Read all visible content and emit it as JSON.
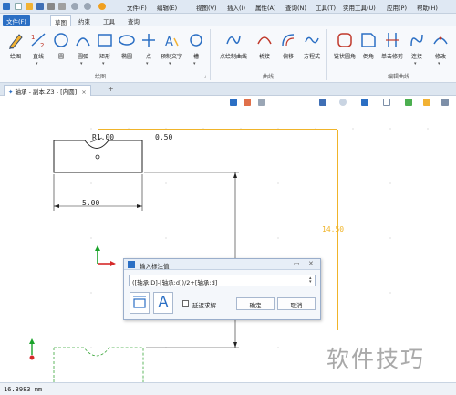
{
  "titlebar": {
    "menu": [
      "文件(F)",
      "编辑(E)",
      "视图(V)",
      "插入(I)",
      "属性(A)",
      "查询(N)",
      "工具(T)",
      "实用工具(U)",
      "应用(P)",
      "帮助(H)"
    ]
  },
  "ribbon_tabs": [
    "文件(F)",
    "草图",
    "约束",
    "工具",
    "查询"
  ],
  "ribbon": {
    "tools": [
      {
        "label": "绘图"
      },
      {
        "label": "直线"
      },
      {
        "label": "圆"
      },
      {
        "label": "圆弧"
      },
      {
        "label": "矩形"
      },
      {
        "label": "椭圆"
      },
      {
        "label": "点"
      },
      {
        "label": "预制文字"
      },
      {
        "label": "槽"
      },
      {
        "label": "点绘制曲线"
      },
      {
        "label": "桥接"
      },
      {
        "label": "偏移"
      },
      {
        "label": "方程式"
      },
      {
        "label": "链状圆角"
      },
      {
        "label": "倒角"
      },
      {
        "label": "单击修剪"
      },
      {
        "label": "连接"
      },
      {
        "label": "修改"
      }
    ],
    "groups": [
      "绘图",
      "曲线",
      "编辑曲线"
    ]
  },
  "document_tab": {
    "label": "轴承 - 副本.Z3 - [内圆]",
    "close": "×",
    "add": "+"
  },
  "canvas": {
    "dims": {
      "radius": "R1.00",
      "top": "0.50",
      "width": "5.00",
      "height": "14.50"
    }
  },
  "dialog": {
    "title": "输入标注值",
    "expression": "([轴承:D]-[轴承:d])/2+[轴承:d]",
    "checkbox_label": "延迟求解",
    "ok": "确定",
    "cancel": "取消"
  },
  "status": {
    "coord": "16.3983 mm"
  },
  "watermark": {
    "text": "软件技巧"
  },
  "colors": {
    "accent": "#2b6fc4",
    "dimension_orange": "#f0b42a",
    "axis_green": "#1aa32a",
    "axis_red": "#d52a2a"
  }
}
